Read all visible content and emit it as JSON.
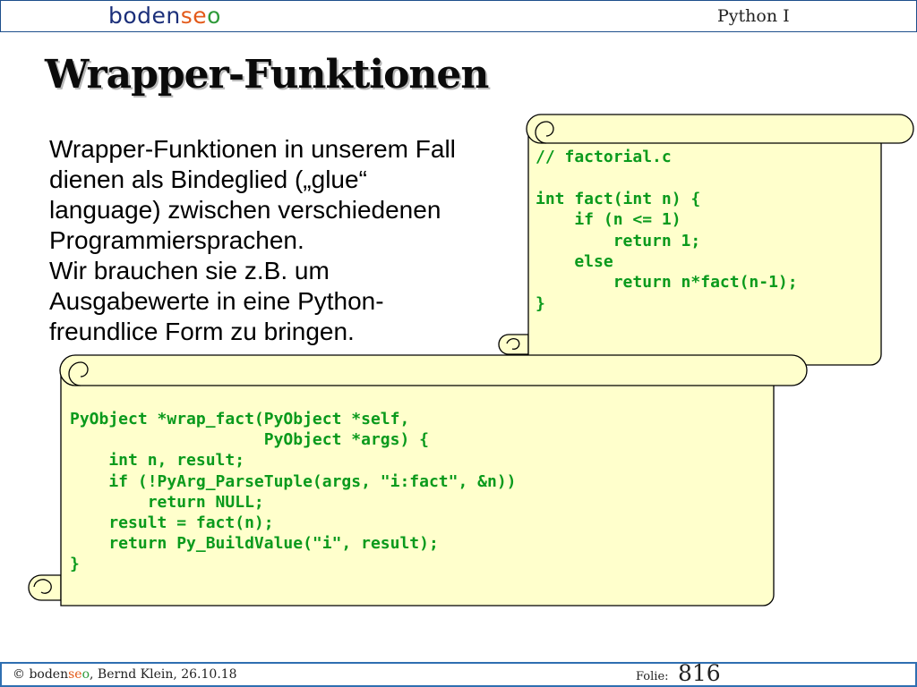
{
  "header": {
    "logo_parts": [
      "boden",
      "se",
      "o"
    ],
    "course_title": "Python I"
  },
  "slide": {
    "title": "Wrapper-Funktionen",
    "body_lines": [
      "Wrapper-Funktionen in unserem Fall",
      "dienen als Bindeglied („glue“",
      "language) zwischen verschiedenen",
      "Programmiersprachen.",
      "Wir brauchen sie z.B. um",
      "Ausgabewerte in eine Python-",
      "freundlice Form zu bringen."
    ]
  },
  "code_scroll_c": {
    "code": "// factorial.c\n\nint fact(int n) {\n    if (n <= 1)\n        return 1;\n    else\n        return n*fact(n-1);\n}"
  },
  "code_scroll_wrapper": {
    "code": "PyObject *wrap_fact(PyObject *self,\n                    PyObject *args) {\n    int n, result;\n    if (!PyArg_ParseTuple(args, \"i:fact\", &n))\n        return NULL;\n    result = fact(n);\n    return Py_BuildValue(\"i\", result);\n}"
  },
  "footer": {
    "copyright_symbol": "©",
    "logo_parts": [
      "boden",
      "se",
      "o"
    ],
    "author_date": ", Bernd Klein, 26.10.18",
    "folio_label": "Folie:",
    "folio_number": "816"
  },
  "colors": {
    "header_blue": "#2f6fb1",
    "scroll_fill": "#ffffcc",
    "code_green": "#0a9a1c",
    "logo_orange": "#e35a1a",
    "logo_green": "#2f9a3a",
    "logo_navy": "#1b2f7a"
  }
}
